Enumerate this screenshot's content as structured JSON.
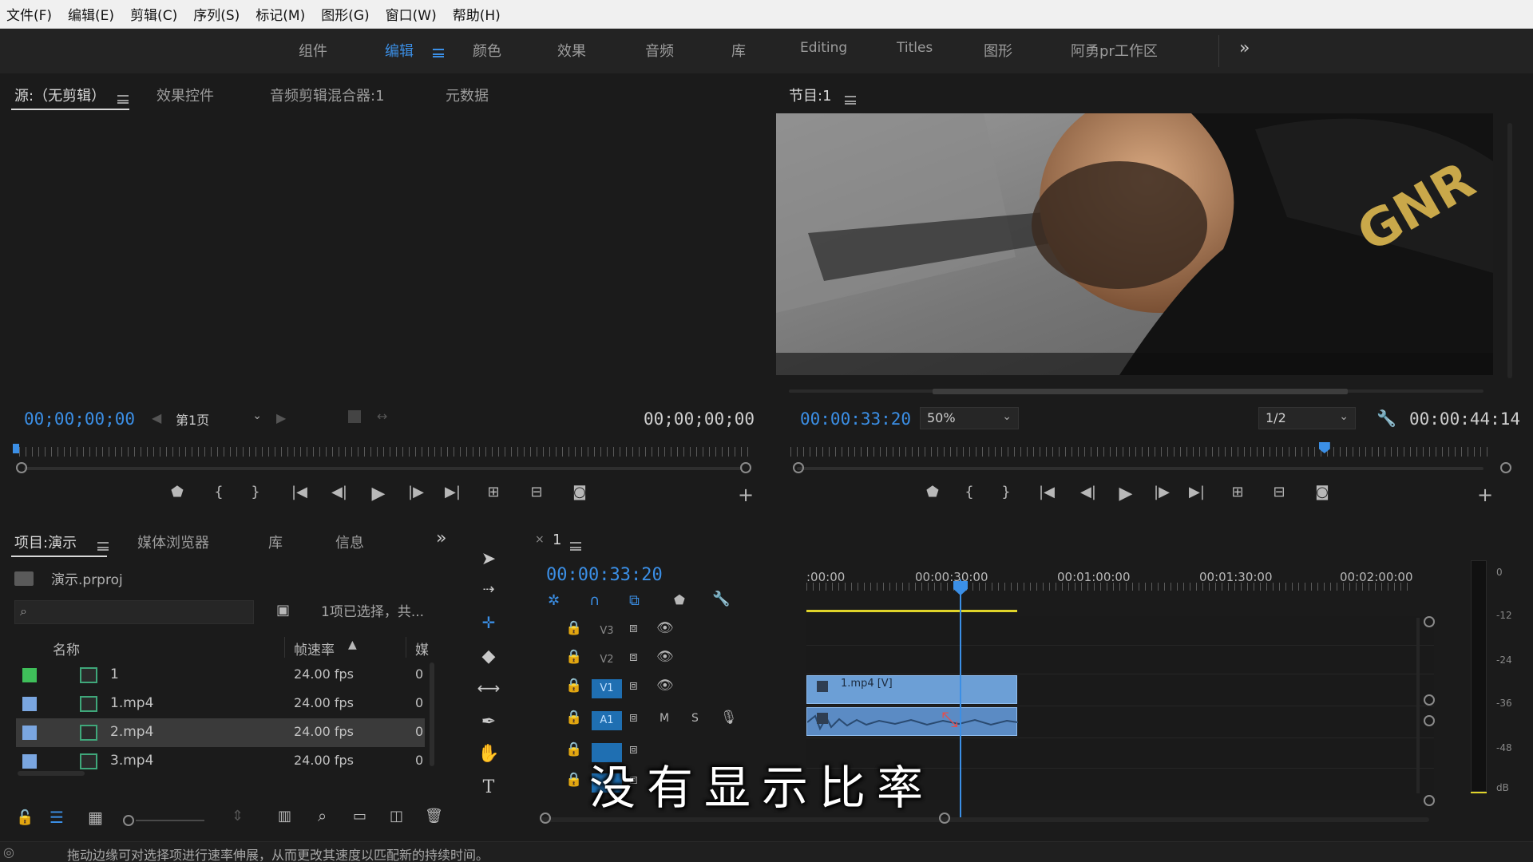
{
  "menu": [
    "文件(F)",
    "编辑(E)",
    "剪辑(C)",
    "序列(S)",
    "标记(M)",
    "图形(G)",
    "窗口(W)",
    "帮助(H)"
  ],
  "workspaces": [
    "组件",
    "编辑",
    "颜色",
    "效果",
    "音频",
    "库",
    "Editing",
    "Titles",
    "图形",
    "阿勇pr工作区"
  ],
  "active_workspace": "编辑",
  "source_panel": {
    "tabs": [
      "源:（无剪辑）",
      "效果控件",
      "音频剪辑混合器:1",
      "元数据"
    ],
    "timecode_in": "00;00;00;00",
    "page_select": "第1页",
    "timecode_out": "00;00;00;00"
  },
  "program_panel": {
    "tab": "节目:1",
    "timecode": "00:00:33:20",
    "zoom": "50%",
    "resolution": "1/2",
    "duration": "00:00:44:14",
    "playhead_fraction": 0.76
  },
  "project_panel": {
    "tabs": [
      "项目:演示",
      "媒体浏览器",
      "库",
      "信息"
    ],
    "project_file": "演示.prproj",
    "search_placeholder": "",
    "selection_status": "1项已选择，共...",
    "columns": [
      "名称",
      "帧速率",
      "媒"
    ],
    "items": [
      {
        "name": "1",
        "fps": "24.00 fps",
        "extra": "0",
        "color": "#3fbf5a",
        "kind": "sequence"
      },
      {
        "name": "1.mp4",
        "fps": "24.00 fps",
        "extra": "0",
        "color": "#7aa6e0",
        "kind": "clip"
      },
      {
        "name": "2.mp4",
        "fps": "24.00 fps",
        "extra": "0",
        "color": "#7aa6e0",
        "kind": "clip",
        "selected": true
      },
      {
        "name": "3.mp4",
        "fps": "24.00 fps",
        "extra": "0",
        "color": "#7aa6e0",
        "kind": "clip"
      }
    ]
  },
  "timeline": {
    "sequence_name": "1",
    "timecode": "00:00:33:20",
    "ruler_labels": [
      ":00:00",
      "00:00:30:00",
      "00:01:00:00",
      "00:01:30:00",
      "00:02:00:00"
    ],
    "tracks": [
      {
        "label": "V3",
        "type": "video",
        "active": false
      },
      {
        "label": "V2",
        "type": "video",
        "active": false
      },
      {
        "label": "V1",
        "type": "video",
        "active": true
      },
      {
        "label": "A1",
        "type": "audio",
        "active": true,
        "m": "M",
        "s": "S"
      },
      {
        "label": "",
        "type": "audio",
        "active": true
      },
      {
        "label": "",
        "type": "audio",
        "active": true
      }
    ],
    "clip_label": "1.mp4 [V]"
  },
  "meter_labels": [
    "0",
    "-12",
    "-24",
    "-36",
    "-48",
    "dB"
  ],
  "subtitle": "没有显示比率",
  "status_bar": "拖动边缘可对选择项进行速率伸展，从而更改其速度以匹配新的持续时间。",
  "colors": {
    "accent": "#3b8fe6",
    "clip_video": "#6c9fd6",
    "playhead": "#3b8fe6",
    "work_area": "#e0d42a"
  }
}
